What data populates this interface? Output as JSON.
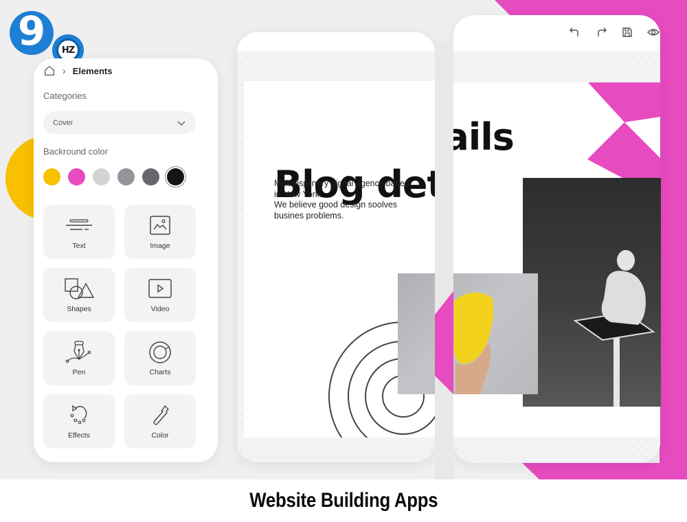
{
  "brand": {
    "logo_main": "9",
    "logo_badge": "HZ",
    "logo_color": "#1e7fd6"
  },
  "colors": {
    "pink_accent": "#e64bbf",
    "yellow_accent": "#f9c000",
    "background": "#efefef"
  },
  "elements_panel": {
    "breadcrumb": {
      "home_icon": "home-icon",
      "separator_icon": "chevron-right-icon",
      "current": "Elements"
    },
    "categories_label": "Categories",
    "category_select": {
      "value": "Cover",
      "icon": "chevron-down-icon"
    },
    "background_color_label": "Backround color",
    "swatches": [
      {
        "name": "yellow",
        "color": "#f9c000",
        "selected": false
      },
      {
        "name": "pink",
        "color": "#e64bbf",
        "selected": false
      },
      {
        "name": "light-gray",
        "color": "#d3d3d3",
        "selected": false
      },
      {
        "name": "gray",
        "color": "#94959a",
        "selected": false
      },
      {
        "name": "dark-gray",
        "color": "#66676c",
        "selected": false
      },
      {
        "name": "black",
        "color": "#141414",
        "selected": true
      }
    ],
    "tiles": [
      {
        "label": "Text",
        "icon": "text-lines-icon"
      },
      {
        "label": "Image",
        "icon": "image-icon"
      },
      {
        "label": "Shapes",
        "icon": "shapes-icon"
      },
      {
        "label": "Video",
        "icon": "video-play-icon"
      },
      {
        "label": "Pen",
        "icon": "pen-tool-icon"
      },
      {
        "label": "Charts",
        "icon": "donut-chart-icon"
      },
      {
        "label": "Effects",
        "icon": "effects-icon"
      },
      {
        "label": "Color",
        "icon": "eyedropper-icon"
      }
    ]
  },
  "canvas": {
    "title": "Blog details",
    "description_lines": [
      "Multidisplinary digital agency based",
      "in New York.",
      "We believe good design soolves",
      "busines problems."
    ]
  },
  "toolbar": {
    "undo_icon": "undo-icon",
    "redo_icon": "redo-icon",
    "save_icon": "save-icon",
    "preview_icon": "eye-icon"
  },
  "caption": "Website Building Apps"
}
